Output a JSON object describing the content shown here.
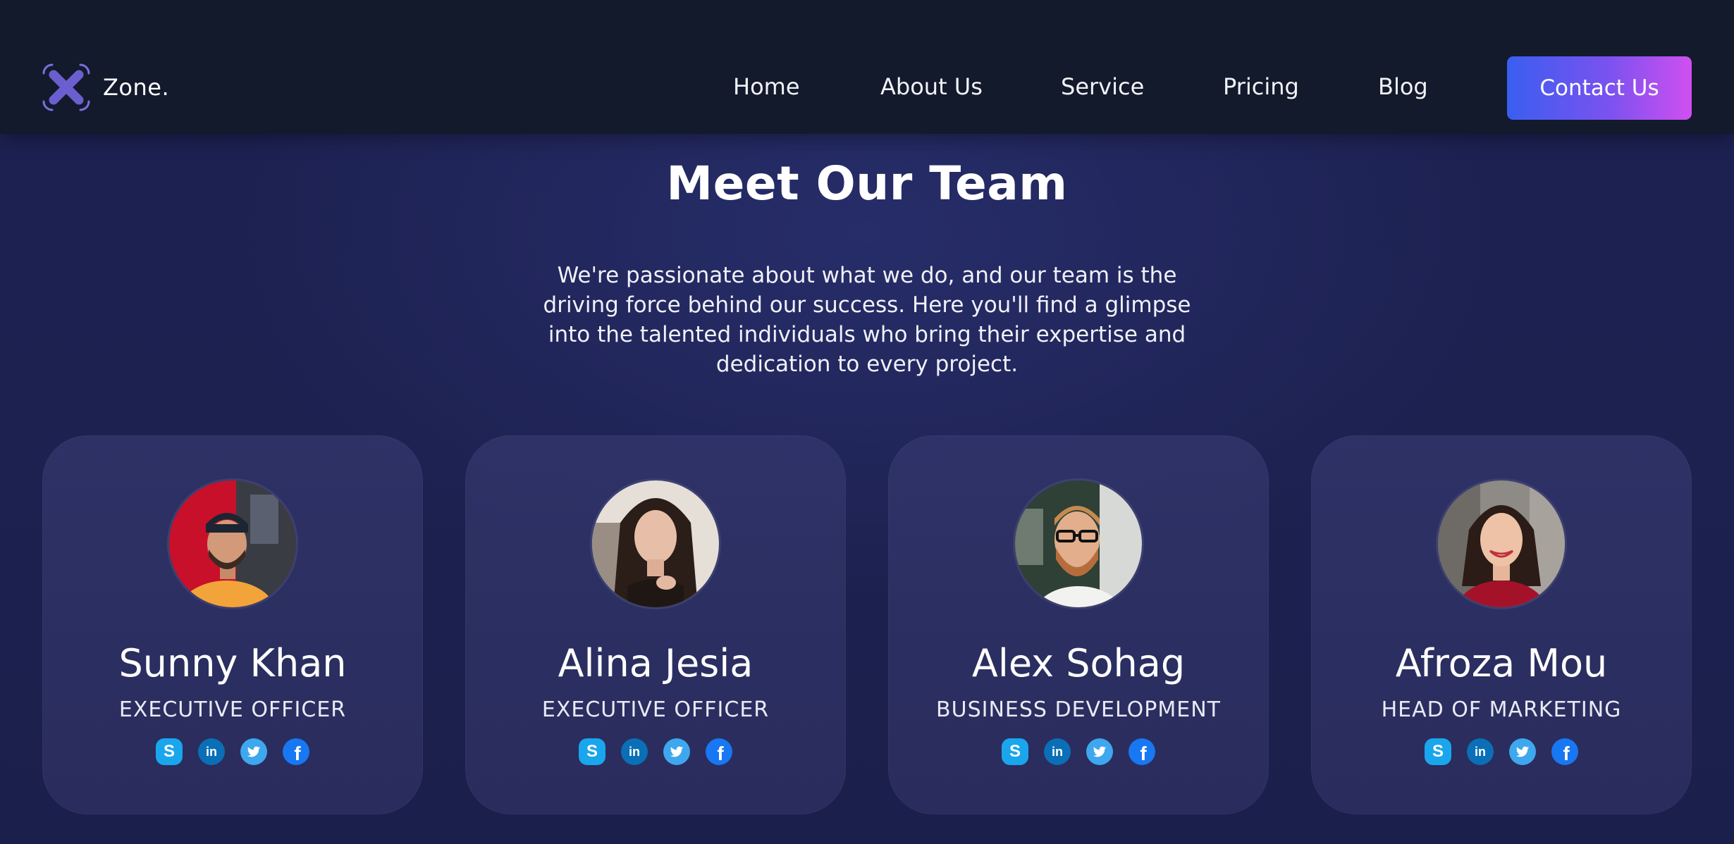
{
  "header": {
    "brand_name": "Zone.",
    "brand_icon": "drone-icon",
    "nav": [
      {
        "label": "Home"
      },
      {
        "label": "About Us"
      },
      {
        "label": "Service"
      },
      {
        "label": "Pricing"
      },
      {
        "label": "Blog"
      }
    ],
    "cta_label": "Contact Us"
  },
  "hero": {
    "title": "Meet Our Team",
    "intro": "We're passionate about what we do, and our team is the driving force behind our success. Here you'll find a glimpse into the talented individuals who bring their expertise and dedication to every project."
  },
  "team": [
    {
      "name": "Sunny Khan",
      "role": "EXECUTIVE OFFICER"
    },
    {
      "name": "Alina Jesia",
      "role": "EXECUTIVE OFFICER"
    },
    {
      "name": "Alex Sohag",
      "role": "BUSINESS DEVELOPMENT"
    },
    {
      "name": "Afroza Mou",
      "role": "HEAD OF MARKETING"
    }
  ],
  "social_icons": [
    "skype-icon",
    "linkedin-icon",
    "twitter-icon",
    "facebook-icon"
  ],
  "colors": {
    "header_bg": "#121a2c",
    "page_bg": "#1d2150",
    "card_bg": "#34386e",
    "cta_gradient_start": "#3a5ef0",
    "cta_gradient_end": "#d04ff0",
    "brand_icon": "#6b5fd0"
  }
}
